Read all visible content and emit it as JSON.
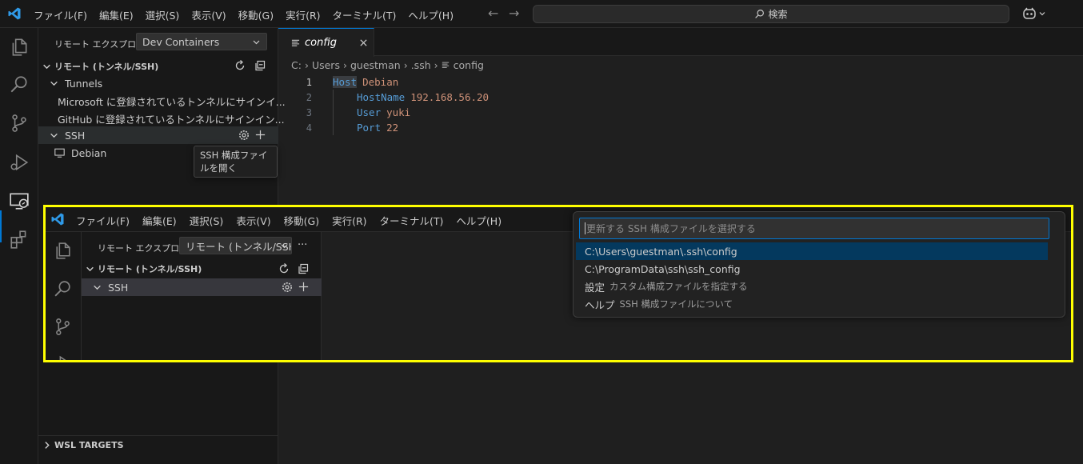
{
  "titlebar": {
    "menu": [
      "ファイル(F)",
      "編集(E)",
      "選択(S)",
      "表示(V)",
      "移動(G)",
      "実行(R)",
      "ターミナル(T)",
      "ヘルプ(H)"
    ],
    "search_label": "検索"
  },
  "sidebar": {
    "explorer_label": "リモート エクスプローラー",
    "explorer_select": "Dev Containers",
    "section_title": "リモート (トンネル/SSH)",
    "tunnels_label": "Tunnels",
    "tunnel_items": [
      "Microsoft に登録されているトンネルにサインイ...",
      "GitHub に登録されているトンネルにサインイン..."
    ],
    "ssh_label": "SSH",
    "ssh_hosts": [
      "Debian"
    ],
    "tooltip": "SSH 構成ファイルを開く",
    "wsl_title": "WSL TARGETS"
  },
  "editor": {
    "tab_label": "config",
    "breadcrumb": [
      "C:",
      "Users",
      "guestman",
      ".ssh",
      "config"
    ],
    "lines": [
      {
        "num": "1",
        "keyword": "Host",
        "value": "Debian"
      },
      {
        "num": "2",
        "keyword": "HostName",
        "value": "192.168.56.20"
      },
      {
        "num": "3",
        "keyword": "User",
        "value": "yuki"
      },
      {
        "num": "4",
        "keyword": "Port",
        "value": "22"
      }
    ]
  },
  "inset": {
    "menu": [
      "ファイル(F)",
      "編集(E)",
      "選択(S)",
      "表示(V)",
      "移動(G)",
      "実行(R)",
      "ターミナル(T)",
      "ヘルプ(H)"
    ],
    "explorer_label": "リモート エクスプローラー",
    "explorer_select": "リモート (トンネル/SSH",
    "more_label": "···",
    "section_title": "リモート (トンネル/SSH)",
    "ssh_label": "SSH",
    "quickpick": {
      "placeholder": "更新する SSH 構成ファイルを選択する",
      "items": [
        {
          "label": "C:\\Users\\guestman\\.ssh\\config",
          "desc": ""
        },
        {
          "label": "C:\\ProgramData\\ssh\\ssh_config",
          "desc": ""
        },
        {
          "label": "設定",
          "desc": "カスタム構成ファイルを指定する"
        },
        {
          "label": "ヘルプ",
          "desc": "SSH 構成ファイルについて"
        }
      ]
    }
  },
  "colors": {
    "accent": "#0078d4",
    "highlight_border": "#ffff00",
    "keyword": "#569cd6",
    "value": "#ce9178",
    "selected_item": "#04395e"
  }
}
